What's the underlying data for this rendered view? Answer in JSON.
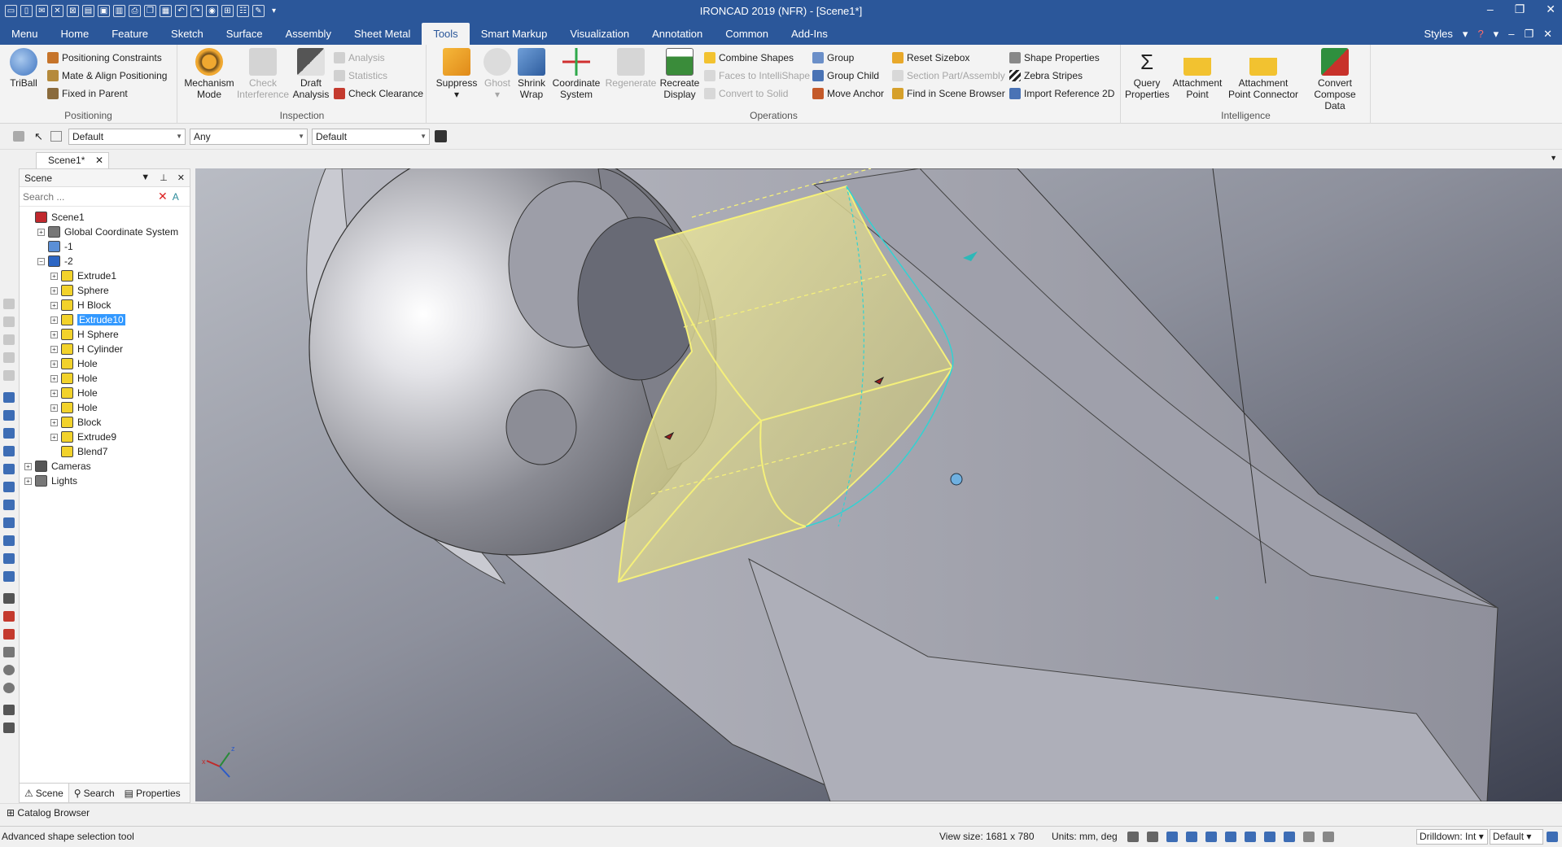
{
  "window": {
    "title": "IRONCAD 2019 (NFR) - [Scene1*]",
    "minimize": "–",
    "restore": "❐",
    "close": "✕"
  },
  "menu": {
    "items": [
      "Menu",
      "Home",
      "Feature",
      "Sketch",
      "Surface",
      "Assembly",
      "Sheet Metal",
      "Tools",
      "Smart Markup",
      "Visualization",
      "Annotation",
      "Common",
      "Add-Ins"
    ],
    "active": "Tools",
    "styles": "Styles"
  },
  "ribbon": {
    "positioning": {
      "label": "Positioning",
      "triball": "TriBall",
      "positioning_constraints": "Positioning Constraints",
      "mate_align": "Mate & Align Positioning",
      "fixed_in_parent": "Fixed in Parent"
    },
    "inspection": {
      "label": "Inspection",
      "mechanism_mode_1": "Mechanism",
      "mechanism_mode_2": "Mode",
      "check_interference_1": "Check",
      "check_interference_2": "Interference",
      "draft_analysis_1": "Draft",
      "draft_analysis_2": "Analysis",
      "analysis": "Analysis",
      "statistics": "Statistics",
      "check_clearance": "Check Clearance"
    },
    "operations": {
      "label": "Operations",
      "suppress": "Suppress",
      "ghost": "Ghost",
      "shrink_wrap_1": "Shrink",
      "shrink_wrap_2": "Wrap",
      "coordinate_system_1": "Coordinate",
      "coordinate_system_2": "System",
      "regenerate": "Regenerate",
      "recreate_display_1": "Recreate",
      "recreate_display_2": "Display",
      "combine_shapes": "Combine Shapes",
      "faces_to_intellishape": "Faces to IntelliShape",
      "convert_to_solid": "Convert to Solid",
      "group": "Group",
      "group_child": "Group Child",
      "move_anchor": "Move Anchor",
      "reset_sizebox": "Reset Sizebox",
      "section_part": "Section Part/Assembly",
      "find_in_scene_browser": "Find in Scene Browser",
      "shape_properties": "Shape Properties",
      "zebra_stripes": "Zebra Stripes",
      "import_reference_2d": "Import Reference 2D"
    },
    "intelligence": {
      "label": "Intelligence",
      "query_properties_1": "Query",
      "query_properties_2": "Properties",
      "attachment_point_1": "Attachment",
      "attachment_point_2": "Point",
      "attachment_point_connector_1": "Attachment",
      "attachment_point_connector_2": "Point Connector",
      "convert_compose_data_1": "Convert",
      "convert_compose_data_2": "Compose Data"
    }
  },
  "toolbar2": {
    "combo1": "Default",
    "combo2": "Any",
    "combo3": "Default"
  },
  "doc_tab": "Scene1*",
  "scene_panel": {
    "title": "Scene",
    "search_placeholder": "Search ...",
    "tree": [
      {
        "label": "Scene1",
        "level": 0,
        "exp": "",
        "icon": "#c0282d"
      },
      {
        "label": "Global Coordinate System",
        "level": 1,
        "exp": "+",
        "icon": "#777777"
      },
      {
        "label": "-1",
        "level": 1,
        "exp": "",
        "icon": "#5b8fd6"
      },
      {
        "label": "-2",
        "level": 1,
        "exp": "−",
        "icon": "#2d66c4"
      },
      {
        "label": "Extrude1",
        "level": 2,
        "exp": "+",
        "icon": "#f2d22b"
      },
      {
        "label": "Sphere",
        "level": 2,
        "exp": "+",
        "icon": "#f2d22b"
      },
      {
        "label": "H Block",
        "level": 2,
        "exp": "+",
        "icon": "#f2d22b"
      },
      {
        "label": "Extrude10",
        "level": 2,
        "exp": "+",
        "icon": "#f2d22b",
        "selected": true
      },
      {
        "label": "H Sphere",
        "level": 2,
        "exp": "+",
        "icon": "#f2d22b"
      },
      {
        "label": "H Cylinder",
        "level": 2,
        "exp": "+",
        "icon": "#f2d22b"
      },
      {
        "label": "Hole",
        "level": 2,
        "exp": "+",
        "icon": "#f2d22b"
      },
      {
        "label": "Hole",
        "level": 2,
        "exp": "+",
        "icon": "#f2d22b"
      },
      {
        "label": "Hole",
        "level": 2,
        "exp": "+",
        "icon": "#f2d22b"
      },
      {
        "label": "Hole",
        "level": 2,
        "exp": "+",
        "icon": "#f2d22b"
      },
      {
        "label": "Block",
        "level": 2,
        "exp": "+",
        "icon": "#f2d22b"
      },
      {
        "label": "Extrude9",
        "level": 2,
        "exp": "+",
        "icon": "#f2d22b"
      },
      {
        "label": "Blend7",
        "level": 2,
        "exp": "",
        "icon": "#f2d22b"
      },
      {
        "label": "Cameras",
        "level": 0,
        "exp": "+",
        "icon": "#555555"
      },
      {
        "label": "Lights",
        "level": 0,
        "exp": "+",
        "icon": "#777777"
      }
    ],
    "tabs": [
      "Scene",
      "Search",
      "Properties"
    ],
    "active_tab": "Scene"
  },
  "catalog_browser": "Catalog Browser",
  "status": {
    "message": "Advanced shape selection tool",
    "view_size": "View size: 1681 x 780",
    "units": "Units: mm, deg",
    "drilldown": "Drilldown: Int",
    "style": "Default"
  },
  "colors": {
    "accent": "#2b579a",
    "selection": "#3399ff",
    "highlight_yellow": "#f5f07a"
  }
}
